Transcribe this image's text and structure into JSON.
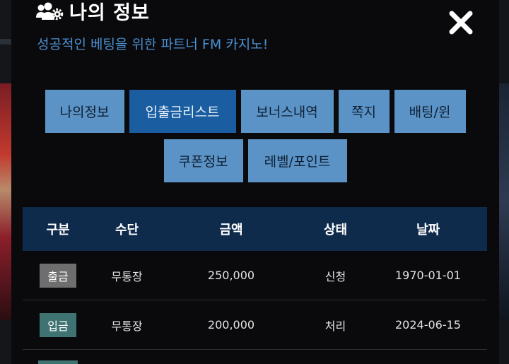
{
  "header": {
    "title": "나의 정보",
    "subtitle": "성공적인 베팅을 위한 파트너 FM 카지노!"
  },
  "tabs": [
    {
      "label": "나의정보",
      "active": false
    },
    {
      "label": "입출금리스트",
      "active": true
    },
    {
      "label": "보너스내역",
      "active": false
    },
    {
      "label": "쪽지",
      "active": false
    },
    {
      "label": "배팅/윈",
      "active": false
    },
    {
      "label": "쿠폰정보",
      "active": false
    },
    {
      "label": "레벨/포인트",
      "active": false
    }
  ],
  "table": {
    "headers": [
      "구분",
      "수단",
      "금액",
      "상태",
      "날짜"
    ],
    "rows": [
      {
        "type": "출금",
        "method": "무통장",
        "amount": "250,000",
        "status": "신청",
        "date": "1970-01-01"
      },
      {
        "type": "입금",
        "method": "무통장",
        "amount": "200,000",
        "status": "처리",
        "date": "2024-06-15"
      }
    ]
  },
  "colors": {
    "accent": "#1a5ea1",
    "tab": "#5b93c6",
    "subtitle": "#4c8fd0",
    "table_header": "#0f2b4c",
    "withdraw_badge": "#6e6e6e",
    "deposit_badge": "#3f7371"
  },
  "icons": {
    "title_icon": "users-cog-icon",
    "close": "close-icon"
  }
}
